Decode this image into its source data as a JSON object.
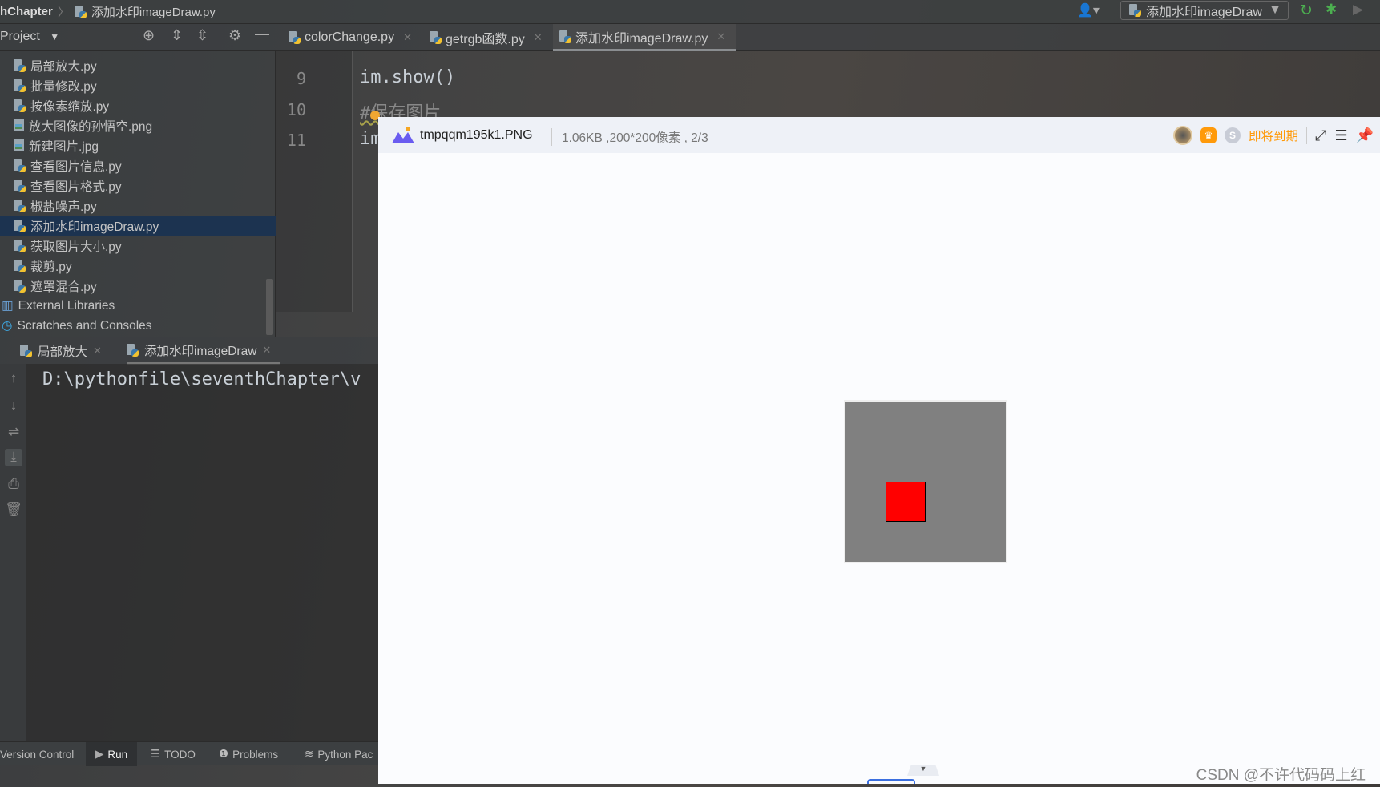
{
  "breadcrumb": {
    "project": "hChapter",
    "file": "添加水印imageDraw.py"
  },
  "run_config": {
    "label": "添加水印imageDraw"
  },
  "project_panel": {
    "title": "Project"
  },
  "editor_tabs": [
    {
      "label": "colorChange.py"
    },
    {
      "label": "getrgb函数.py"
    },
    {
      "label": "添加水印imageDraw.py",
      "active": true
    }
  ],
  "files": [
    {
      "name": "局部放大.py",
      "type": "py"
    },
    {
      "name": "批量修改.py",
      "type": "py"
    },
    {
      "name": "按像素缩放.py",
      "type": "py"
    },
    {
      "name": "放大图像的孙悟空.png",
      "type": "img"
    },
    {
      "name": "新建图片.jpg",
      "type": "img"
    },
    {
      "name": "查看图片信息.py",
      "type": "py"
    },
    {
      "name": "查看图片格式.py",
      "type": "py"
    },
    {
      "name": "椒盐噪声.py",
      "type": "py"
    },
    {
      "name": "添加水印imageDraw.py",
      "type": "py",
      "selected": true
    },
    {
      "name": "获取图片大小.py",
      "type": "py"
    },
    {
      "name": "裁剪.py",
      "type": "py"
    },
    {
      "name": "遮罩混合.py",
      "type": "py"
    }
  ],
  "tree_extra": {
    "external": "External Libraries",
    "scratches": "Scratches and Consoles"
  },
  "code": {
    "lines": [
      {
        "n": "9",
        "text": "im.show()"
      },
      {
        "n": "10",
        "text": "#保存图片"
      },
      {
        "n": "11",
        "text": "im"
      }
    ]
  },
  "run_tabs": [
    {
      "label": "局部放大"
    },
    {
      "label": "添加水印imageDraw",
      "active": true
    }
  ],
  "console": {
    "line": "D:\\pythonfile\\seventhChapter\\v"
  },
  "status_bar": {
    "vc": "Version Control",
    "run": "Run",
    "todo": "TODO",
    "problems": "Problems",
    "python": "Python Pac"
  },
  "viewer": {
    "filename": "tmpqqm195k1.PNG",
    "size": "1.06KB",
    "dims": "200*200像素",
    "index": ", 2/3",
    "expiry": "即将到期",
    "image_bg": "#808080",
    "square_color": "#ff0000"
  },
  "watermark": "CSDN @不许代码码上红"
}
